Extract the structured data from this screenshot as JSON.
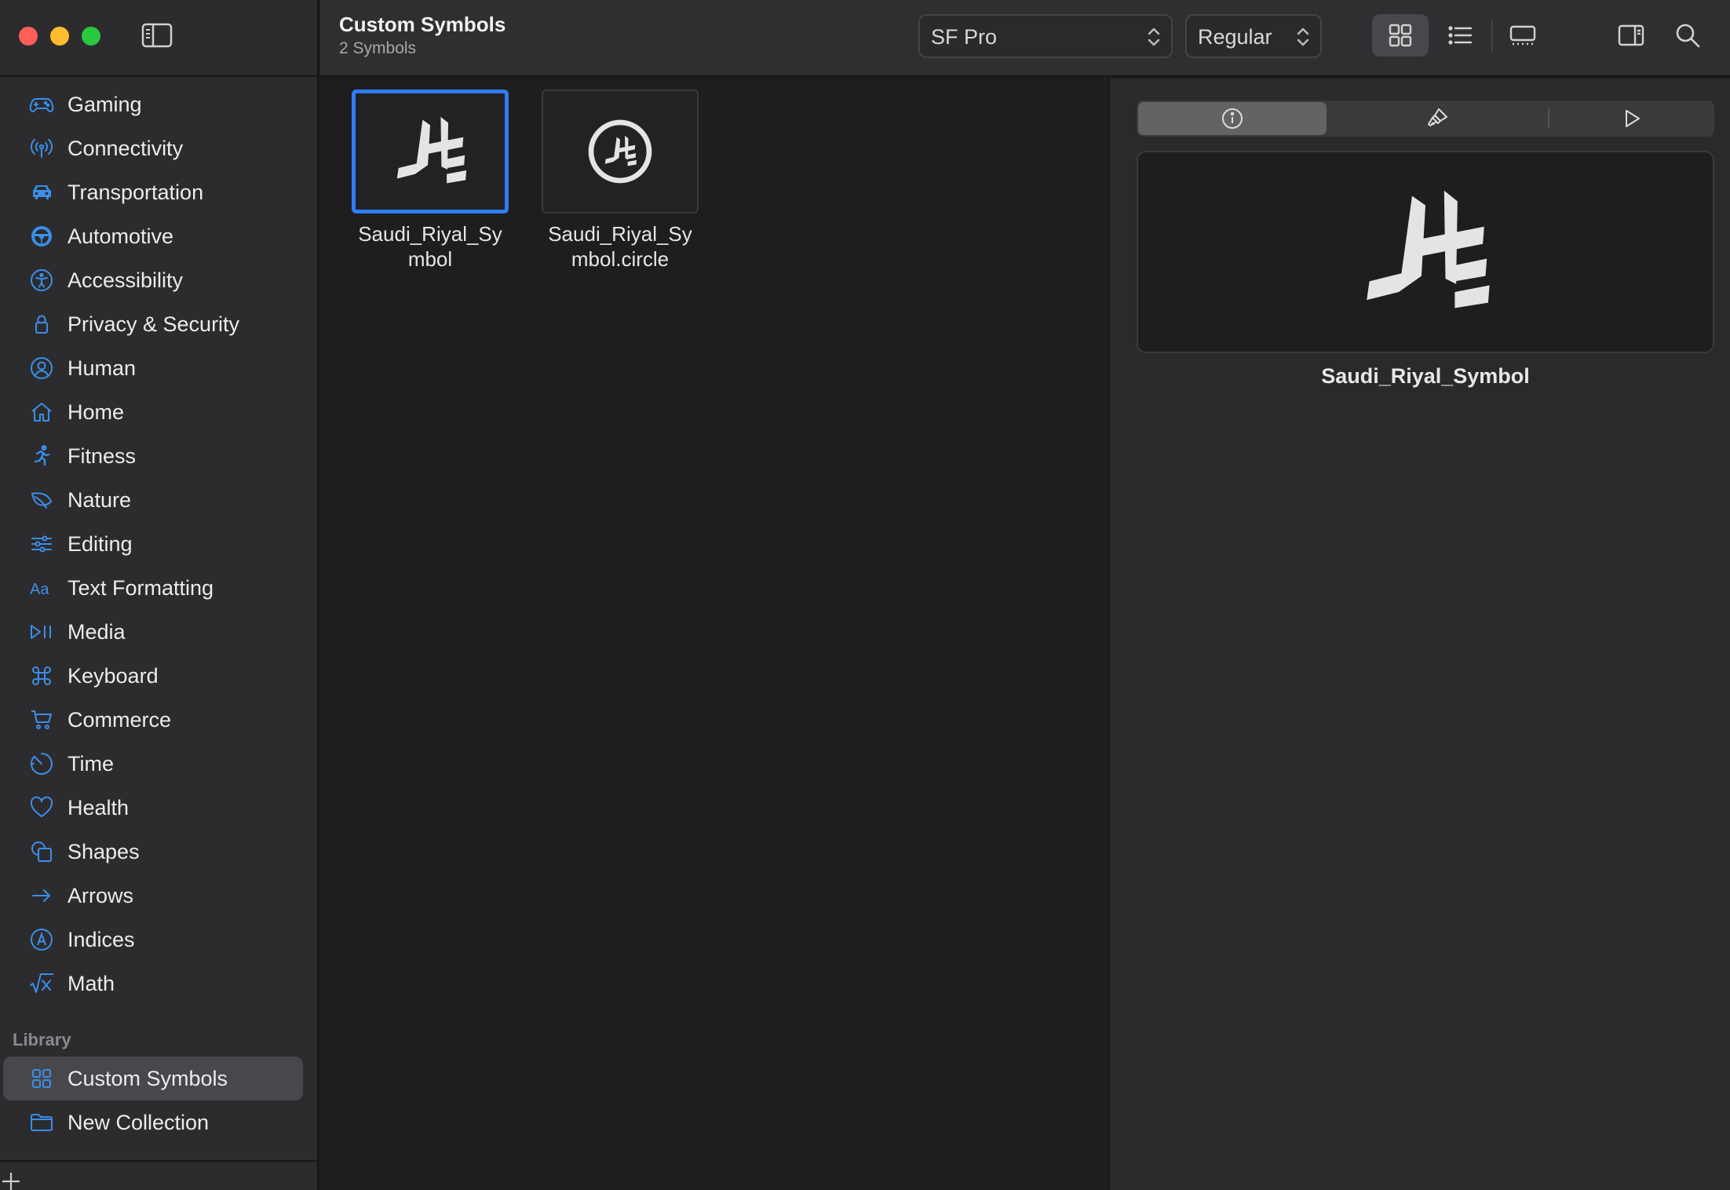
{
  "window": {
    "title": "Custom Symbols",
    "subtitle": "2 Symbols"
  },
  "toolbar": {
    "font_value": "SF Pro",
    "weight_value": "Regular",
    "views": [
      "grid-view",
      "list-view",
      "gallery-view"
    ],
    "active_view": "grid-view"
  },
  "sidebar": {
    "categories": [
      {
        "label": "Gaming",
        "icon": "gamecontroller-icon"
      },
      {
        "label": "Connectivity",
        "icon": "antenna-icon"
      },
      {
        "label": "Transportation",
        "icon": "car-icon"
      },
      {
        "label": "Automotive",
        "icon": "steering-wheel-icon"
      },
      {
        "label": "Accessibility",
        "icon": "accessibility-icon"
      },
      {
        "label": "Privacy & Security",
        "icon": "lock-icon"
      },
      {
        "label": "Human",
        "icon": "person-circle-icon"
      },
      {
        "label": "Home",
        "icon": "house-icon"
      },
      {
        "label": "Fitness",
        "icon": "figure-run-icon"
      },
      {
        "label": "Nature",
        "icon": "leaf-icon"
      },
      {
        "label": "Editing",
        "icon": "sliders-icon"
      },
      {
        "label": "Text Formatting",
        "icon": "textformat-icon"
      },
      {
        "label": "Media",
        "icon": "play-pause-icon"
      },
      {
        "label": "Keyboard",
        "icon": "command-icon"
      },
      {
        "label": "Commerce",
        "icon": "cart-icon"
      },
      {
        "label": "Time",
        "icon": "clock-icon"
      },
      {
        "label": "Health",
        "icon": "heart-icon"
      },
      {
        "label": "Shapes",
        "icon": "shapes-icon"
      },
      {
        "label": "Arrows",
        "icon": "arrow-right-icon"
      },
      {
        "label": "Indices",
        "icon": "a-circle-icon"
      },
      {
        "label": "Math",
        "icon": "square-root-icon"
      }
    ],
    "library_header": "Library",
    "library": [
      {
        "label": "Custom Symbols",
        "icon": "grid-icon",
        "selected": true
      },
      {
        "label": "New Collection",
        "icon": "folder-icon",
        "selected": false
      }
    ]
  },
  "symbols": [
    {
      "name": "Saudi_Riyal_Symbol",
      "selected": true
    },
    {
      "name": "Saudi_Riyal_Symbol.circle",
      "selected": false
    }
  ],
  "inspector": {
    "tabs": [
      "info-icon",
      "paintbrush-icon",
      "play-icon"
    ],
    "active_tab": "info-icon",
    "selected_name": "Saudi_Riyal_Symbol"
  },
  "colors": {
    "accent": "#3b8eea",
    "selection": "#2f7cf6",
    "close": "#ff5f57",
    "minimize": "#febc2e",
    "zoom": "#28c840"
  }
}
